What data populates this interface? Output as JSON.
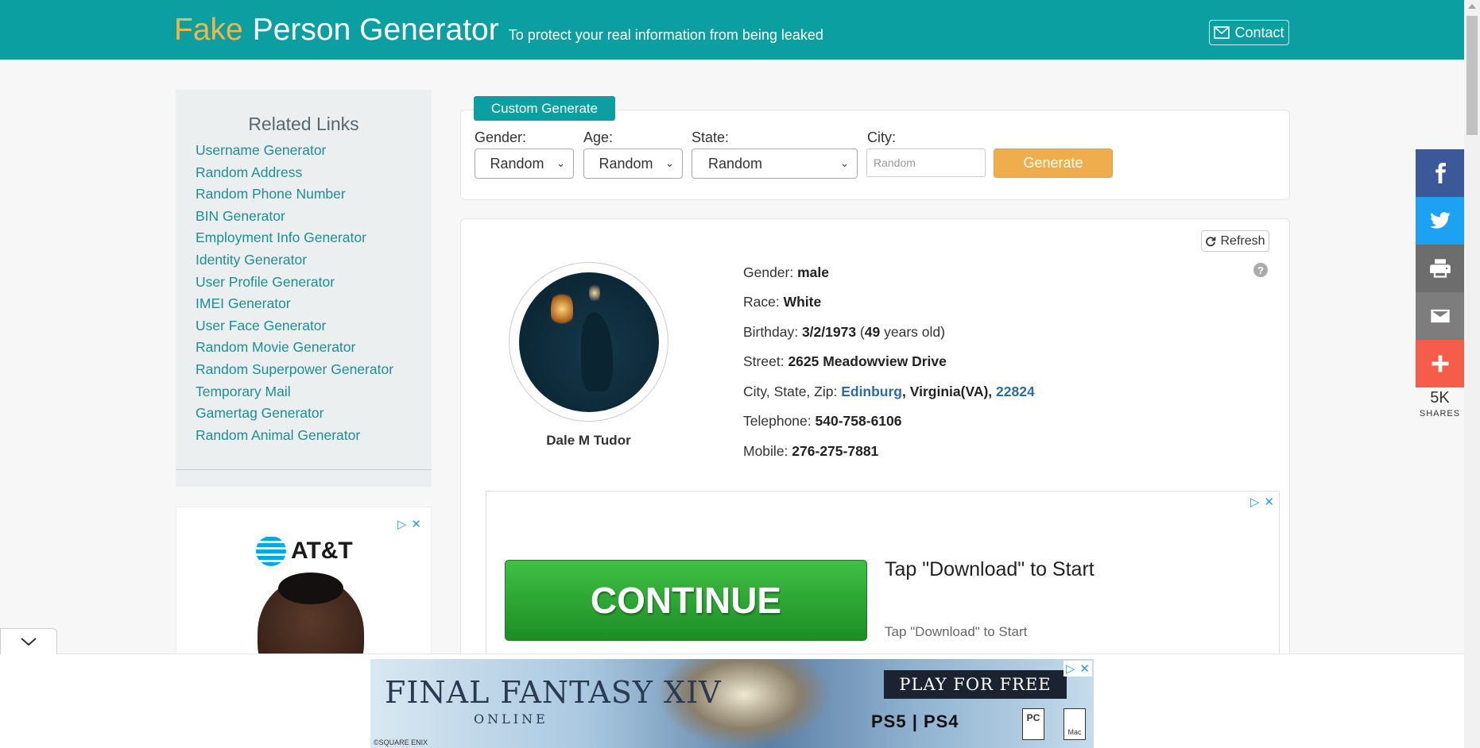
{
  "header": {
    "brand_fake": "Fake",
    "brand_rest": "Person Generator",
    "tagline": "To protect your real information from being leaked",
    "contact_label": "Contact",
    "bg_color": "#0b9fa2"
  },
  "sidebar": {
    "title": "Related Links",
    "links": [
      "Username Generator",
      "Random Address",
      "Random Phone Number",
      "BIN Generator",
      "Employment Info Generator",
      "Identity Generator",
      "User Profile Generator",
      "IMEI Generator",
      "User Face Generator",
      "Random Movie Generator",
      "Random Superpower Generator",
      "Temporary Mail",
      "Gamertag Generator",
      "Random Animal Generator"
    ]
  },
  "side_ad": {
    "brand": "AT&T"
  },
  "custom_generate": {
    "tab_label": "Custom Generate",
    "gender_label": "Gender:",
    "gender_value": "Random",
    "age_label": "Age:",
    "age_value": "Random",
    "state_label": "State:",
    "state_value": "Random",
    "city_label": "City:",
    "city_placeholder": "Random",
    "generate_label": "Generate"
  },
  "result": {
    "refresh_label": "Refresh",
    "name": "Dale M Tudor",
    "gender_label": "Gender:",
    "gender": "male",
    "race_label": "Race:",
    "race": "White",
    "birthday_label": "Birthday:",
    "birthday": "3/2/1973",
    "age": "49",
    "age_suffix": "years old)",
    "street_label": "Street:",
    "street": "2625 Meadowview Drive",
    "csz_label": "City, State, Zip:",
    "city": "Edinburg",
    "state": "Virginia(VA)",
    "zip": "22824",
    "telephone_label": "Telephone:",
    "telephone": "540-758-6106",
    "mobile_label": "Mobile:",
    "mobile": "276-275-7881"
  },
  "content_ad": {
    "button": "CONTINUE",
    "title": "Tap \"Download\" to Start",
    "subtitle": "Tap \"Download\" to Start"
  },
  "share": {
    "count": "5K",
    "label": "SHARES",
    "colors": {
      "facebook": "#3b5998",
      "twitter": "#1da1f2",
      "print": "#6d6d6d",
      "email": "#7d7d7d",
      "more": "#f65c4a"
    }
  },
  "bottom_ad": {
    "title": "FINAL FANTASY XIV",
    "subtitle": "ONLINE",
    "cta": "PLAY FOR FREE",
    "platforms": "PS5 | PS4",
    "pc": "PC",
    "mac": "Mac",
    "copyright": "©SQUARE ENIX"
  }
}
